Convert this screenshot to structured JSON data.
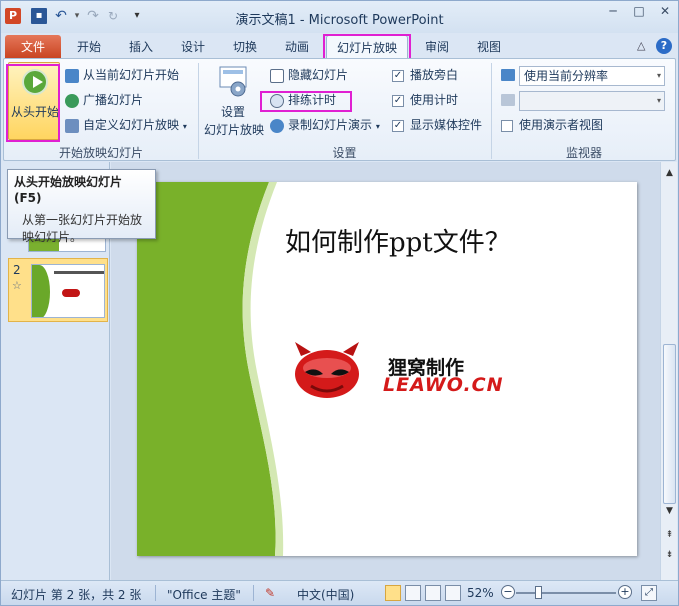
{
  "window": {
    "title": "演示文稿1 - Microsoft PowerPoint",
    "app_icon": "P",
    "controls": {
      "minimize": "─",
      "maximize": "□",
      "close": "✕"
    }
  },
  "qat": {
    "save_glyph": "▪",
    "undo_glyph": "↶",
    "undo_arrow": "▾",
    "redo_glyph": "↷",
    "repeat_glyph": "↻",
    "more_glyph": "▾"
  },
  "tabs": {
    "file": "文件",
    "items": [
      "开始",
      "插入",
      "设计",
      "切换",
      "动画",
      "幻灯片放映",
      "审阅",
      "视图"
    ],
    "active": "幻灯片放映",
    "minimize_glyph": "△",
    "help_glyph": "?"
  },
  "ribbon": {
    "start_group": {
      "big_button": "从头开始",
      "from_current": "从当前幻灯片开始",
      "broadcast": "广播幻灯片",
      "custom": "自定义幻灯片放映",
      "custom_arrow": "▾",
      "label": "开始放映幻灯片"
    },
    "setup_group": {
      "setup_label1": "设置",
      "setup_label2": "幻灯片放映",
      "hide_slide": "隐藏幻灯片",
      "rehearse": "排练计时",
      "record": "录制幻灯片演示",
      "record_arrow": "▾",
      "play_narrations": "播放旁白",
      "use_timings": "使用计时",
      "show_media": "显示媒体控件",
      "label": "设置"
    },
    "monitors_group": {
      "resolution": "使用当前分辨率",
      "show_on": "",
      "presenter_view": "使用演示者视图",
      "label": "监视器",
      "arrow": "▾"
    },
    "checked_glyph": "✓"
  },
  "tooltip": {
    "title": "从头开始放映幻灯片 (F5)",
    "body": "从第一张幻灯片开始放映幻灯片。"
  },
  "thumbnails": {
    "slide2_number": "2",
    "slide2_star": "☆"
  },
  "slide": {
    "title": "如何制作ppt文件？",
    "logo_cn": "狸窝制作",
    "logo_en": "LEAWO.CN"
  },
  "scrollbar": {
    "up": "▲",
    "down": "▼",
    "prev": "⇞",
    "next": "⇟"
  },
  "status": {
    "slide_info": "幻灯片 第 2 张，共 2 张",
    "theme": "\"Office 主题\"",
    "language": "中文(中国)",
    "zoom": "52%",
    "zoom_out": "−",
    "zoom_in": "+",
    "fit_glyph": "⤢",
    "spell_glyph": "✎"
  },
  "colors": {
    "accent_highlight": "#e020d2",
    "file_tab": "#d24726",
    "slide_green": "#7ab02f",
    "logo_red": "#d41a1a"
  }
}
